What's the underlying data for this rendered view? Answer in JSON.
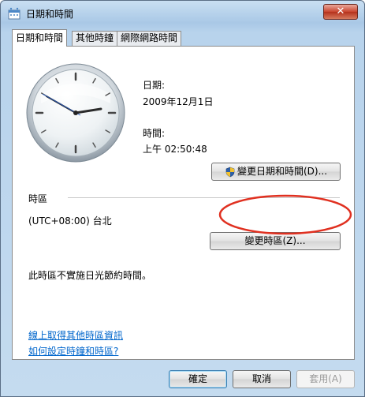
{
  "window": {
    "title": "日期和時間",
    "close_glyph": "✕"
  },
  "tabs": [
    {
      "label": "日期和時間",
      "active": true
    },
    {
      "label": "其他時鐘",
      "active": false
    },
    {
      "label": "網際網路時間",
      "active": false
    }
  ],
  "date_section": {
    "date_label": "日期:",
    "date_value": "2009年12月1日",
    "time_label": "時間:",
    "time_value": "上午 02:50:48",
    "change_button": "變更日期和時間(D)..."
  },
  "timezone_section": {
    "header": "時區",
    "value": "(UTC+08:00) 台北",
    "change_button": "變更時區(Z)...",
    "dst_note": "此時區不實施日光節約時間。"
  },
  "links": {
    "online_info": "線上取得其他時區資訊",
    "how_to": "如何設定時鐘和時區?"
  },
  "footer": {
    "ok": "確定",
    "cancel": "取消",
    "apply": "套用(A)"
  },
  "colors": {
    "annotation_circle": "#e03020",
    "link": "#0066cc"
  },
  "icons": [
    "clock-icon",
    "uac-shield-icon"
  ]
}
